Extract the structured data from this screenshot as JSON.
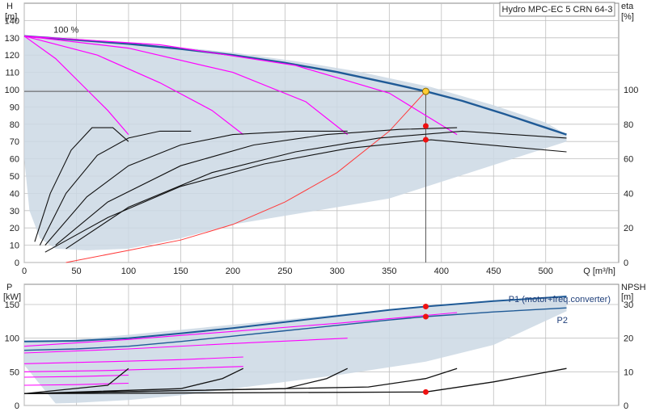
{
  "chart_data": [
    {
      "type": "line",
      "title": "Hydro MPC-EC 5 CRN 64-3",
      "ylabel_left": "H",
      "ylabel_left_unit": "[m]",
      "ylabel_right": "eta",
      "ylabel_right_unit": "[%]",
      "xlabel": "Q [m³/h]",
      "xlim": [
        0,
        570
      ],
      "ylim_left": [
        0,
        150
      ],
      "ylim_right": [
        0,
        100
      ],
      "x_ticks": [
        0,
        50,
        100,
        150,
        200,
        250,
        300,
        350,
        400,
        450,
        500
      ],
      "y_ticks_left": [
        0,
        10,
        20,
        30,
        40,
        50,
        60,
        70,
        80,
        90,
        100,
        110,
        120,
        130,
        140
      ],
      "y_ticks_right": [
        0,
        20,
        40,
        60,
        80,
        100
      ],
      "annotations": [
        {
          "text": "100 %",
          "x": 28,
          "y": 133
        }
      ],
      "colors": {
        "envelope": "#cbd8e4",
        "qh_main": "#1f5a96",
        "speed": "#ff00ff",
        "system": "#ff3b3b",
        "eta": "#111111",
        "duty": "#ffcc33",
        "point": "#ee1111",
        "grid": "#bfbfbf"
      },
      "envelope": {
        "x": [
          0,
          20,
          30,
          60,
          100,
          150,
          200,
          260,
          320,
          390,
          450,
          500,
          520,
          520,
          350,
          200,
          150,
          100,
          60,
          30,
          15,
          5,
          0
        ],
        "y": [
          131,
          131,
          130.5,
          129,
          127,
          124.5,
          121.5,
          116.5,
          110.5,
          101.5,
          91,
          81,
          74,
          70,
          37,
          22,
          14,
          8,
          7,
          8,
          14,
          30,
          60
        ]
      },
      "series": [
        {
          "kind": "qh_main",
          "x": [
            0,
            50,
            100,
            150,
            200,
            250,
            300,
            350,
            385,
            420,
            460,
            490,
            520
          ],
          "y": [
            131,
            128.8,
            126.5,
            123.6,
            120.0,
            115.5,
            110.2,
            103.8,
            99.0,
            93.5,
            86.0,
            80.0,
            74.0
          ]
        },
        {
          "kind": "speed",
          "x": [
            0,
            30,
            60,
            80,
            100
          ],
          "y": [
            131,
            118,
            100,
            88,
            74
          ]
        },
        {
          "kind": "speed",
          "x": [
            0,
            70,
            130,
            180,
            210
          ],
          "y": [
            131,
            120,
            104,
            88,
            74
          ]
        },
        {
          "kind": "speed",
          "x": [
            0,
            100,
            200,
            270,
            310
          ],
          "y": [
            131,
            124,
            110,
            93,
            74
          ]
        },
        {
          "kind": "speed",
          "x": [
            0,
            130,
            260,
            350,
            415
          ],
          "y": [
            131,
            126,
            114,
            98,
            74
          ]
        },
        {
          "kind": "system",
          "x": [
            40,
            100,
            150,
            200,
            250,
            300,
            350,
            385
          ],
          "y": [
            0,
            7,
            13,
            22,
            35,
            52,
            76,
            99
          ]
        },
        {
          "kind": "eta",
          "x": [
            10,
            25,
            45,
            65,
            85,
            100
          ],
          "y": [
            12,
            40,
            65,
            78,
            78,
            70
          ]
        },
        {
          "kind": "eta",
          "x": [
            15,
            40,
            70,
            100,
            130,
            160
          ],
          "y": [
            10,
            40,
            62,
            72,
            76,
            76
          ]
        },
        {
          "kind": "eta",
          "x": [
            20,
            60,
            100,
            150,
            200,
            260,
            310
          ],
          "y": [
            10,
            38,
            56,
            68,
            74,
            76,
            76
          ]
        },
        {
          "kind": "eta",
          "x": [
            30,
            80,
            150,
            220,
            290,
            360,
            415
          ],
          "y": [
            10,
            35,
            56,
            68,
            74,
            77,
            78
          ]
        },
        {
          "kind": "eta",
          "x": [
            40,
            100,
            180,
            260,
            340,
            420,
            520
          ],
          "y": [
            8,
            32,
            52,
            64,
            72,
            76,
            72
          ]
        },
        {
          "kind": "eta",
          "x": [
            20,
            80,
            150,
            230,
            310,
            390,
            520
          ],
          "y": [
            6,
            26,
            44,
            57,
            66,
            71,
            64
          ]
        }
      ],
      "duty_point": {
        "x": 385,
        "y": 99
      },
      "points": [
        {
          "x": 385,
          "y": 79
        },
        {
          "x": 385,
          "y": 71
        }
      ]
    },
    {
      "type": "line",
      "ylabel_left": "P",
      "ylabel_left_unit": "[kW]",
      "ylabel_right": "NPSH",
      "ylabel_right_unit": "[m]",
      "xlim": [
        0,
        570
      ],
      "ylim_left": [
        0,
        180
      ],
      "ylim_right": [
        0,
        36
      ],
      "y_ticks_left": [
        0,
        50,
        100,
        150
      ],
      "y_ticks_right": [
        0,
        10,
        20,
        30
      ],
      "legend_labels": [
        "P1 (motor+freq.converter)",
        "P2"
      ],
      "envelope": {
        "x": [
          0,
          30,
          100,
          200,
          300,
          385,
          450,
          520,
          520,
          450,
          385,
          300,
          200,
          150,
          100,
          50,
          30,
          0
        ],
        "y": [
          95,
          95,
          105,
          120,
          135,
          148,
          155,
          162,
          140,
          90,
          65,
          45,
          25,
          15,
          8,
          4,
          3,
          60
        ]
      },
      "series": [
        {
          "kind": "p1",
          "x": [
            0,
            50,
            100,
            150,
            200,
            250,
            300,
            350,
            385,
            450,
            520
          ],
          "y": [
            95,
            96,
            100,
            107,
            115,
            124,
            133,
            142,
            147,
            155,
            162
          ]
        },
        {
          "kind": "p2",
          "x": [
            0,
            50,
            100,
            150,
            200,
            250,
            300,
            350,
            385,
            450,
            520
          ],
          "y": [
            82,
            84,
            88,
            95,
            103,
            111,
            119,
            127,
            132,
            139,
            145
          ]
        },
        {
          "kind": "pspeed",
          "x": [
            0,
            100,
            200,
            300,
            415
          ],
          "y": [
            88,
            98,
            110,
            122,
            138
          ]
        },
        {
          "kind": "pspeed",
          "x": [
            0,
            100,
            200,
            310
          ],
          "y": [
            78,
            84,
            92,
            100
          ]
        },
        {
          "kind": "pspeed",
          "x": [
            0,
            80,
            150,
            210
          ],
          "y": [
            62,
            65,
            68,
            72
          ]
        },
        {
          "kind": "pspeed",
          "x": [
            0,
            50,
            100
          ],
          "y": [
            42,
            43,
            45
          ]
        },
        {
          "kind": "pspeed",
          "x": [
            0,
            50,
            100
          ],
          "y": [
            30,
            31,
            33
          ]
        },
        {
          "kind": "pspeed",
          "x": [
            0,
            80,
            150,
            210
          ],
          "y": [
            50,
            52,
            55,
            58
          ]
        },
        {
          "kind": "npsh",
          "x": [
            0,
            80,
            100
          ],
          "y": [
            3.5,
            6,
            11
          ]
        },
        {
          "kind": "npsh",
          "x": [
            0,
            150,
            190,
            210
          ],
          "y": [
            3.5,
            5,
            8,
            11
          ]
        },
        {
          "kind": "npsh",
          "x": [
            0,
            250,
            290,
            310
          ],
          "y": [
            3.5,
            5,
            8,
            11
          ]
        },
        {
          "kind": "npsh",
          "x": [
            0,
            330,
            385,
            415
          ],
          "y": [
            3.5,
            5.5,
            8,
            11
          ]
        },
        {
          "kind": "npsh",
          "x": [
            0,
            385,
            450,
            520
          ],
          "y": [
            3.5,
            4,
            7,
            11
          ]
        }
      ],
      "points": [
        {
          "x": 385,
          "y": 147
        },
        {
          "x": 385,
          "y": 132
        },
        {
          "x": 385,
          "y": 4
        }
      ]
    }
  ]
}
